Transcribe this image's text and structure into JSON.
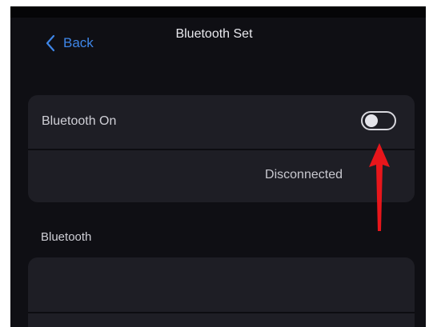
{
  "header": {
    "back_label": "Back",
    "title": "Bluetooth Set"
  },
  "bluetooth_card": {
    "toggle_label": "Bluetooth On",
    "toggle_state": "off",
    "status": "Disconnected"
  },
  "devices_section": {
    "label": "Bluetooth"
  },
  "colors": {
    "background": "#0f0f14",
    "card": "#1e1e25",
    "accent": "#3e86e8",
    "annotation_arrow": "#e8161b"
  },
  "icons": {
    "back": "chevron-left-icon",
    "annotation": "red-arrow-up-icon"
  }
}
